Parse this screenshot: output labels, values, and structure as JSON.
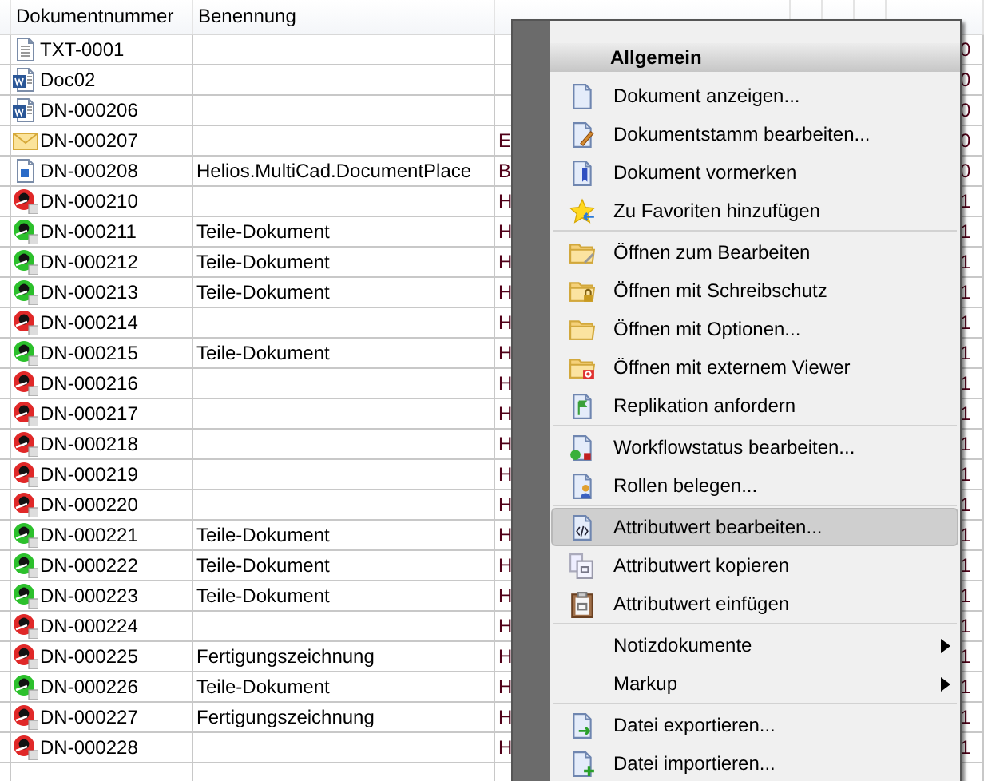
{
  "table": {
    "columns": [
      "Dokumentnummer",
      "Benennung"
    ],
    "rows": [
      {
        "kind": "text",
        "number": "TXT-0001",
        "tail": "0"
      },
      {
        "kind": "word",
        "number": "Doc02",
        "tail": "0"
      },
      {
        "kind": "word",
        "number": "DN-000206",
        "tail": "0"
      },
      {
        "kind": "mail",
        "number": "DN-000207",
        "type": "E",
        "tail": "0"
      },
      {
        "kind": "image",
        "number": "DN-000208",
        "name": "Helios.MultiCad.DocumentPlace",
        "type": "B",
        "tail": "0"
      },
      {
        "kind": "cad",
        "color": "#e02828",
        "number": "DN-000210",
        "type": "H",
        "tail": "1"
      },
      {
        "kind": "cad",
        "color": "#2cc02c",
        "number": "DN-000211",
        "name": "Teile-Dokument",
        "type": "H",
        "tail": "1"
      },
      {
        "kind": "cad",
        "color": "#2cc02c",
        "number": "DN-000212",
        "name": "Teile-Dokument",
        "type": "H",
        "tail": "1"
      },
      {
        "kind": "cad",
        "color": "#2cc02c",
        "number": "DN-000213",
        "name": "Teile-Dokument",
        "type": "H",
        "tail": "1"
      },
      {
        "kind": "cad",
        "color": "#e02828",
        "number": "DN-000214",
        "type": "H",
        "tail": "1"
      },
      {
        "kind": "cad",
        "color": "#2cc02c",
        "number": "DN-000215",
        "name": "Teile-Dokument",
        "type": "H",
        "tail": "1"
      },
      {
        "kind": "cad",
        "color": "#e02828",
        "number": "DN-000216",
        "type": "H",
        "tail": "1"
      },
      {
        "kind": "cad",
        "color": "#e02828",
        "number": "DN-000217",
        "type": "H",
        "tail": "1"
      },
      {
        "kind": "cad",
        "color": "#e02828",
        "number": "DN-000218",
        "type": "H",
        "tail": "1"
      },
      {
        "kind": "cad",
        "color": "#e02828",
        "number": "DN-000219",
        "type": "H",
        "tail": "1"
      },
      {
        "kind": "cad",
        "color": "#e02828",
        "number": "DN-000220",
        "type": "H",
        "tail": "1"
      },
      {
        "kind": "cad",
        "color": "#2cc02c",
        "number": "DN-000221",
        "name": "Teile-Dokument",
        "type": "H",
        "tail": "1"
      },
      {
        "kind": "cad",
        "color": "#2cc02c",
        "number": "DN-000222",
        "name": "Teile-Dokument",
        "type": "H",
        "tail": "1"
      },
      {
        "kind": "cad",
        "color": "#2cc02c",
        "number": "DN-000223",
        "name": "Teile-Dokument",
        "type": "H",
        "tail": "1"
      },
      {
        "kind": "cad",
        "color": "#e02828",
        "number": "DN-000224",
        "type": "H",
        "tail": "1"
      },
      {
        "kind": "cad",
        "color": "#e02828",
        "number": "DN-000225",
        "name": "Fertigungszeichnung",
        "type": "H",
        "tail": "1"
      },
      {
        "kind": "cad",
        "color": "#2cc02c",
        "number": "DN-000226",
        "name": "Teile-Dokument",
        "type": "H",
        "tail": "1"
      },
      {
        "kind": "cad",
        "color": "#e02828",
        "number": "DN-000227",
        "name": "Fertigungszeichnung",
        "type": "H",
        "tail": "1"
      },
      {
        "kind": "cad",
        "color": "#e02828",
        "number": "DN-000228",
        "type": "H",
        "tail": "1"
      }
    ]
  },
  "context_menu": {
    "title": "Allgemein",
    "groups": [
      {
        "items": [
          {
            "label": "Dokument anzeigen...",
            "selected": false
          },
          {
            "label": "Dokumentstamm bearbeiten...",
            "selected": false
          },
          {
            "label": "Dokument vormerken",
            "selected": false
          },
          {
            "label": "Zu Favoriten hinzufügen",
            "selected": false
          }
        ]
      },
      {
        "items": [
          {
            "label": "Öffnen zum Bearbeiten",
            "selected": false
          },
          {
            "label": "Öffnen mit Schreibschutz",
            "selected": false
          },
          {
            "label": "Öffnen mit Optionen...",
            "selected": false
          },
          {
            "label": "Öffnen mit externem Viewer",
            "selected": false
          },
          {
            "label": "Replikation anfordern",
            "selected": false
          }
        ]
      },
      {
        "items": [
          {
            "label": "Workflowstatus bearbeiten...",
            "selected": false
          },
          {
            "label": "Rollen belegen...",
            "selected": false
          }
        ]
      },
      {
        "items": [
          {
            "label": "Attributwert bearbeiten...",
            "selected": true
          },
          {
            "label": "Attributwert kopieren",
            "selected": false
          },
          {
            "label": "Attributwert einfügen",
            "selected": false
          }
        ]
      },
      {
        "items": [
          {
            "label": "Notizdokumente",
            "selected": false,
            "kind": "submenu"
          },
          {
            "label": "Markup",
            "selected": false,
            "kind": "submenu"
          }
        ]
      },
      {
        "items": [
          {
            "label": "Datei exportieren...",
            "selected": false
          },
          {
            "label": "Datei importieren...",
            "selected": false
          }
        ]
      }
    ]
  }
}
